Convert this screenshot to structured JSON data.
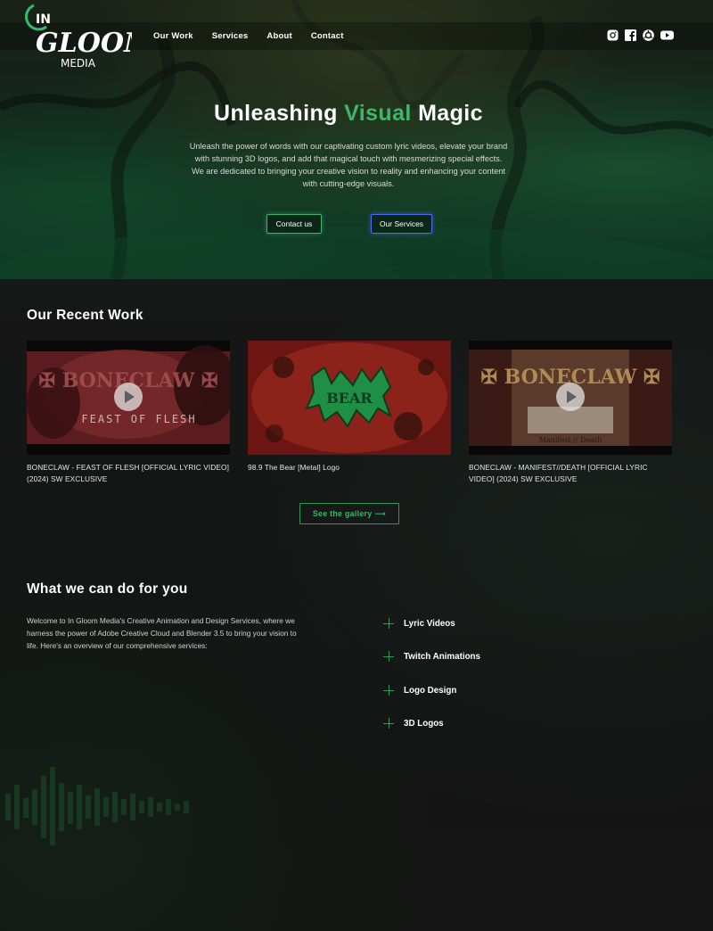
{
  "brand": {
    "logo_line1": "IN",
    "logo_line2": "GLOOM",
    "logo_line3": "MEDIA",
    "accent_color": "#3fb56b"
  },
  "nav": {
    "items": [
      "Our Work",
      "Services",
      "About",
      "Contact"
    ]
  },
  "socials": [
    "instagram-icon",
    "facebook-icon",
    "github-icon",
    "youtube-icon"
  ],
  "hero": {
    "title_pre": "Unleashing ",
    "title_accent": "Visual",
    "title_post": " Magic",
    "description": "Unleash the power of words with our captivating custom lyric videos, elevate your brand with stunning 3D logos, and add that magical touch with mesmerizing special effects. We are dedicated to bringing your creative vision to reality and enhancing your content with cutting-edge visuals.",
    "btn_contact": "Contact us",
    "btn_services": "Our Services"
  },
  "recent": {
    "title": "Our Recent Work",
    "cards": [
      {
        "title": "BONECLAW - FEAST OF FLESH [OFFICIAL LYRIC VIDEO] (2024) SW EXCLUSIVE",
        "thumb_text": "FEAST OF FLESH"
      },
      {
        "title": "98.9 The Bear [Metal] Logo",
        "thumb_text": ""
      },
      {
        "title": "BONECLAW - MANIFEST//DEATH [OFFICIAL LYRIC VIDEO] (2024) SW EXCLUSIVE",
        "thumb_text": "Manifest // Death"
      }
    ],
    "gallery_btn": "See the gallery ⟶"
  },
  "services": {
    "title": "What we can do for you",
    "description": "Welcome to In Gloom Media's Creative Animation and Design Services, where we harness the power of Adobe Creative Cloud and Blender 3.5 to bring your vision to life. Here's an overview of our comprehensive services:",
    "items": [
      "Lyric Videos",
      "Twitch Animations",
      "Logo Design",
      "3D Logos"
    ]
  }
}
